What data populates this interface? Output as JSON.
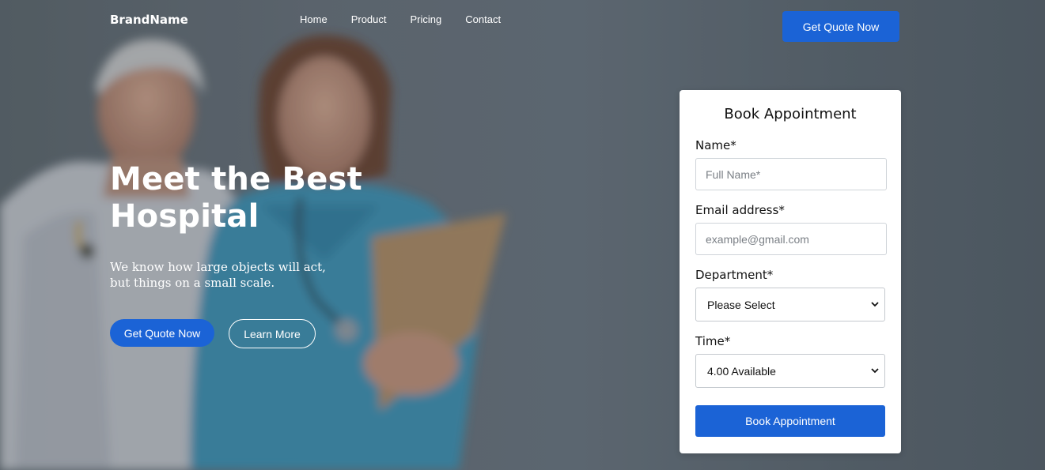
{
  "nav": {
    "brand": "BrandName",
    "links": [
      "Home",
      "Product",
      "Pricing",
      "Contact"
    ],
    "cta_label": "Get Quote Now"
  },
  "hero": {
    "title": "Meet the Best Hospital",
    "subtitle": "We know how large objects will act, but things on a small scale.",
    "primary_label": "Get Quote Now",
    "secondary_label": "Learn More"
  },
  "booking": {
    "title": "Book Appointment",
    "name_label": "Name*",
    "name_placeholder": "Full Name*",
    "email_label": "Email address*",
    "email_placeholder": "example@gmail.com",
    "department_label": "Department*",
    "department_value": "Please Select",
    "time_label": "Time*",
    "time_value": "4.00 Available",
    "submit_label": "Book Appointment"
  },
  "colors": {
    "accent": "#1b63d6",
    "hero_overlay": "#5d676d"
  },
  "icons": {
    "select_arrow": "chevron-down-icon"
  }
}
